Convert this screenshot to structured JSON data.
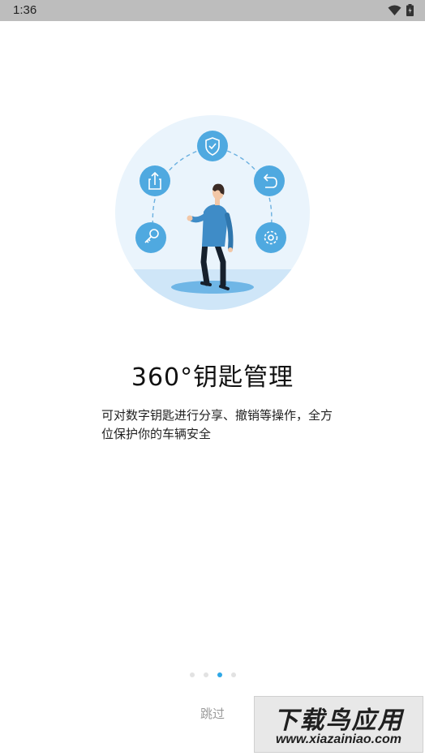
{
  "status_bar": {
    "time": "1:36",
    "icons": [
      "wifi-icon",
      "battery-icon"
    ]
  },
  "onboarding": {
    "title": "360°钥匙管理",
    "description": "可对数字钥匙进行分享、撤销等操作，全方位保护你的车辆安全",
    "illustration_icons": [
      "shield-check-icon",
      "share-icon",
      "undo-icon",
      "key-icon",
      "gear-icon"
    ],
    "page_indicator": {
      "total": 4,
      "current": 3
    },
    "skip_label": "跳过"
  },
  "watermark": {
    "line1": "下载鸟应用",
    "line2": "www.xiazainiao.com"
  },
  "colors": {
    "accent": "#2ea7e6",
    "icon_circle": "#4fa9e0",
    "illustration_bg": "#eaf4fc",
    "floor": "#cfe6f8",
    "status_bar": "#bdbdbd"
  }
}
